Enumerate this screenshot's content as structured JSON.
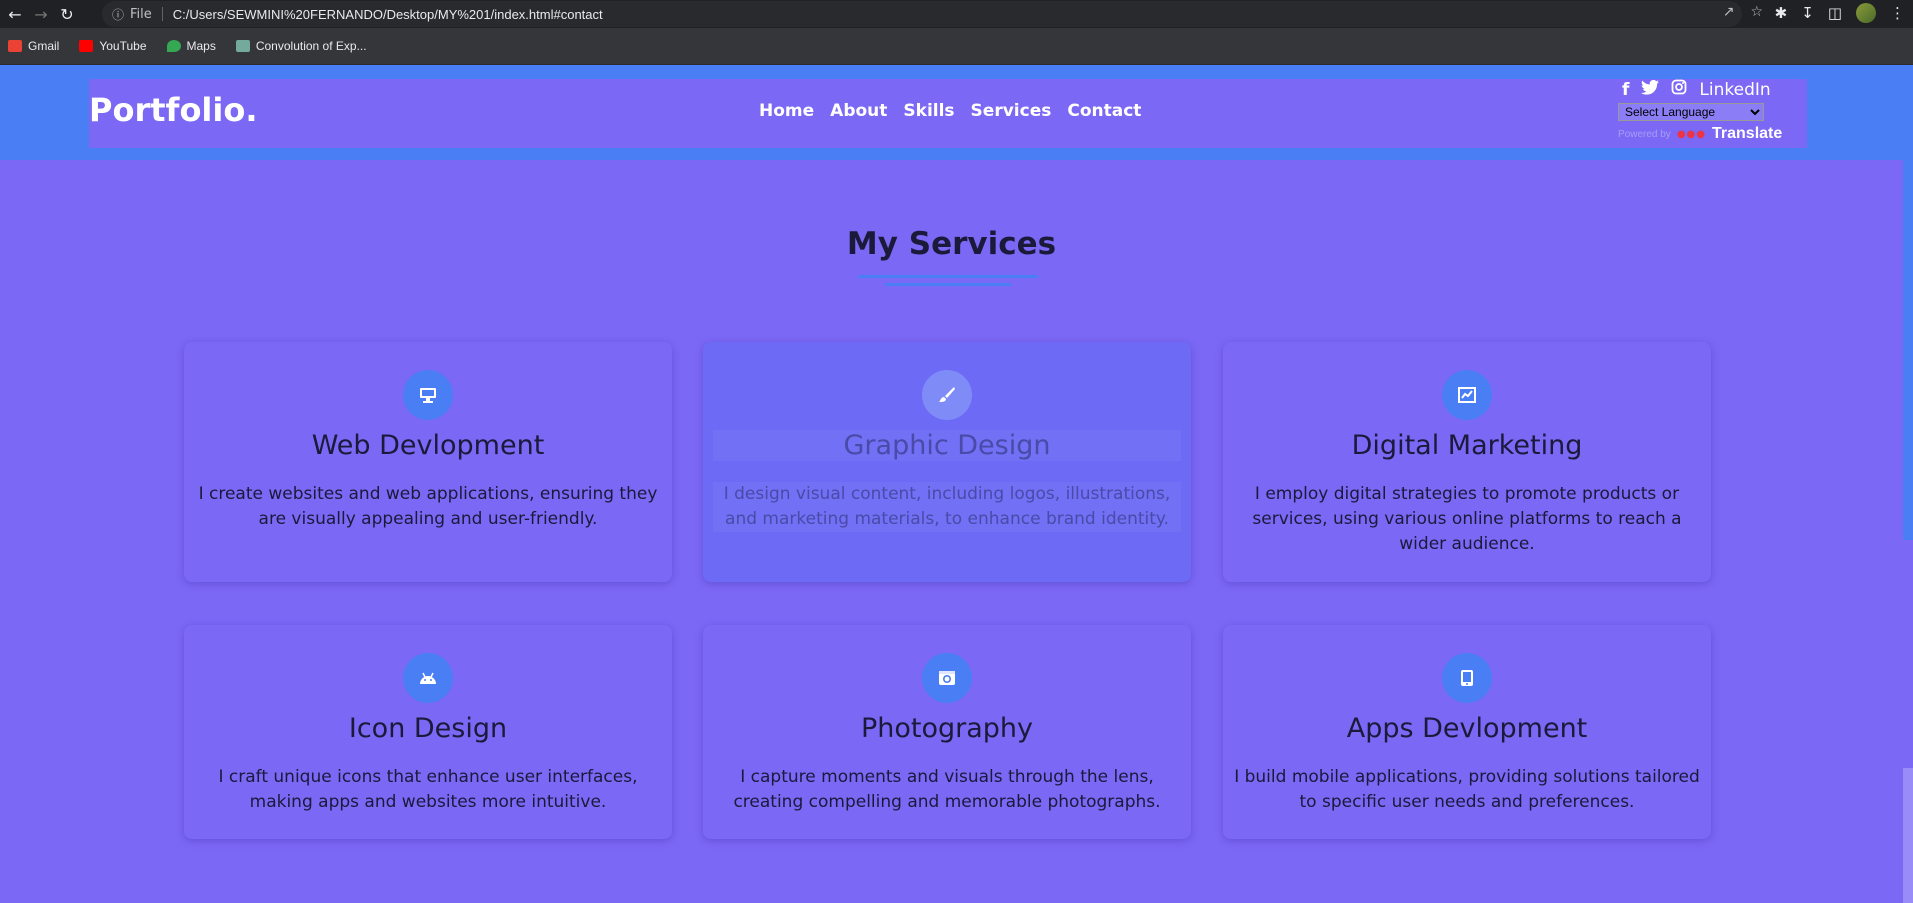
{
  "browser": {
    "file_label": "File",
    "url": "C:/Users/SEWMINI%20FERNANDO/Desktop/MY%201/index.html#contact",
    "bookmarks": [
      {
        "label": "Gmail",
        "color": "#ea4335"
      },
      {
        "label": "YouTube",
        "color": "#ff0000"
      },
      {
        "label": "Maps",
        "color": "#34a853"
      },
      {
        "label": "Convolution of Exp...",
        "color": "#74aa9c"
      }
    ]
  },
  "header": {
    "logo": "Portfolio.",
    "nav": [
      "Home",
      "About",
      "Skills",
      "Services",
      "Contact"
    ],
    "social": {
      "linkedin": "LinkedIn"
    },
    "translate": {
      "select_label": "Select Language",
      "powered_by": "Powered by",
      "translate_label": "Translate"
    }
  },
  "services": {
    "title": "My Services",
    "cards": [
      {
        "title": "Web Devlopment",
        "desc": "I create websites and web applications, ensuring they are visually appealing and user-friendly.",
        "icon": "monitor-icon"
      },
      {
        "title": "Graphic Design",
        "desc": "I design visual content, including logos, illustrations, and marketing materials, to enhance brand identity.",
        "icon": "brush-icon"
      },
      {
        "title": "Digital Marketing",
        "desc": "I employ digital strategies to promote products or services, using various online platforms to reach a wider audience.",
        "icon": "chart-icon"
      },
      {
        "title": "Icon Design",
        "desc": "I craft unique icons that enhance user interfaces, making apps and websites more intuitive.",
        "icon": "android-icon"
      },
      {
        "title": "Photography",
        "desc": "I capture moments and visuals through the lens, creating compelling and memorable photographs.",
        "icon": "camera-icon"
      },
      {
        "title": "Apps Devlopment",
        "desc": "I build mobile applications, providing solutions tailored to specific user needs and preferences.",
        "icon": "tablet-icon"
      }
    ]
  },
  "colors": {
    "accent": "#4a7ef5",
    "background": "#7b68f5",
    "text": "#1a1a3a"
  }
}
